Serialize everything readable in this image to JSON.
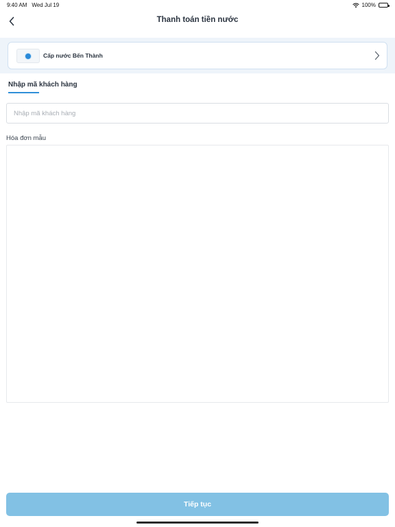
{
  "status_bar": {
    "time": "9:40 AM",
    "date": "Wed Jul 19",
    "battery": "100%"
  },
  "header": {
    "title": "Thanh toán tiền nước",
    "back_icon": "chevron-left-icon"
  },
  "provider": {
    "name": "Cấp nước Bến Thành",
    "chevron_icon": "chevron-right-icon"
  },
  "tabs": [
    {
      "label": "Nhập mã khách hàng",
      "active": true
    }
  ],
  "form": {
    "customer_code_placeholder": "Nhập mã khách hàng",
    "customer_code_value": ""
  },
  "sample_invoice": {
    "label": "Hóa đơn mẫu"
  },
  "actions": {
    "continue_label": "Tiếp tục"
  },
  "colors": {
    "accent": "#2f8fd8",
    "button_disabled": "#82c1e4",
    "provider_bg": "#eef4fa"
  }
}
